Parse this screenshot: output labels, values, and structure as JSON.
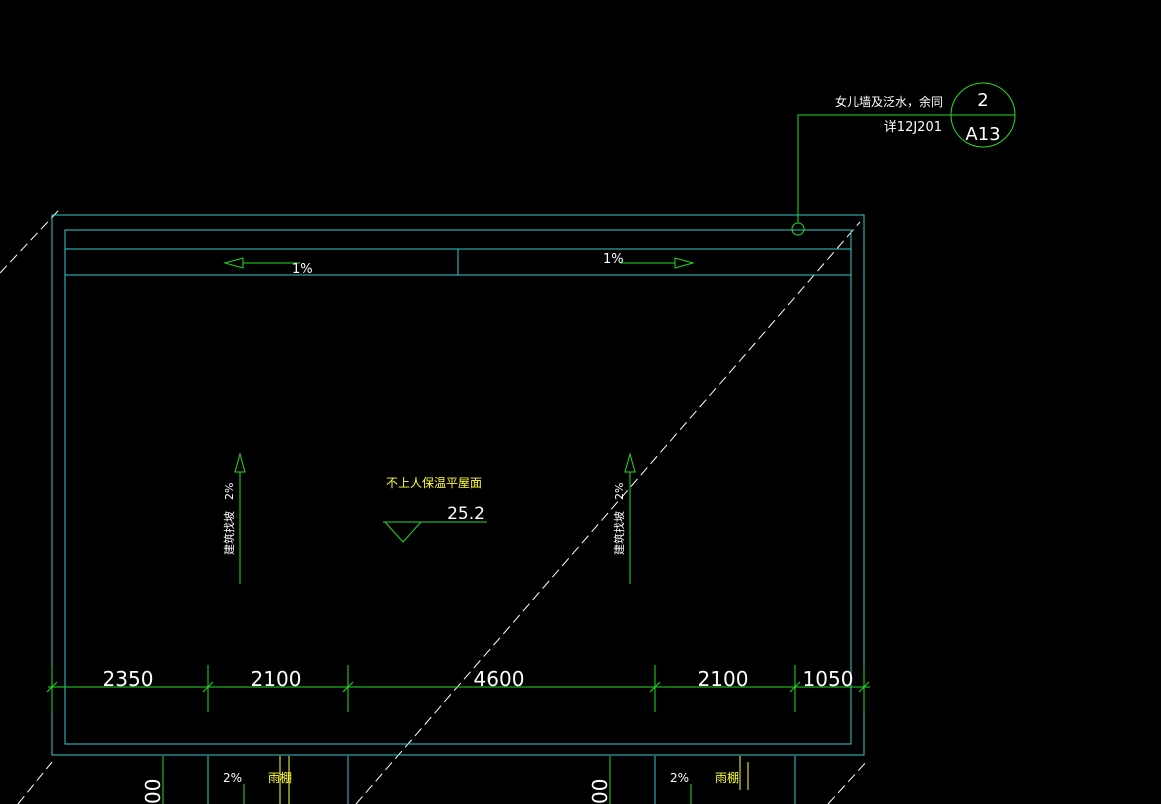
{
  "colors": {
    "background": "#000000",
    "cyan": "#33cccc",
    "green": "#22dd22",
    "white": "#ffffff",
    "yellow": "#ffff33"
  },
  "callout": {
    "note_line1": "女儿墙及泛水，余同",
    "note_line2": "详12J201",
    "detail_number": "2",
    "sheet_number": "A13"
  },
  "gutter": {
    "left_slope": "1%",
    "right_slope": "1%"
  },
  "roof": {
    "label": "不上人保温平屋面",
    "elevation": "25.2",
    "left_slope_text": "建筑找坡",
    "left_slope_value": "2%",
    "right_slope_text": "建筑找坡",
    "right_slope_value": "2%"
  },
  "dimensions": [
    "2350",
    "2100",
    "4600",
    "2100",
    "1050"
  ],
  "canopy": {
    "left_slope": "2%",
    "left_label": "雨棚",
    "right_slope": "2%",
    "right_label": "雨棚",
    "left_cut_dim": "00",
    "right_cut_dim": "00"
  }
}
